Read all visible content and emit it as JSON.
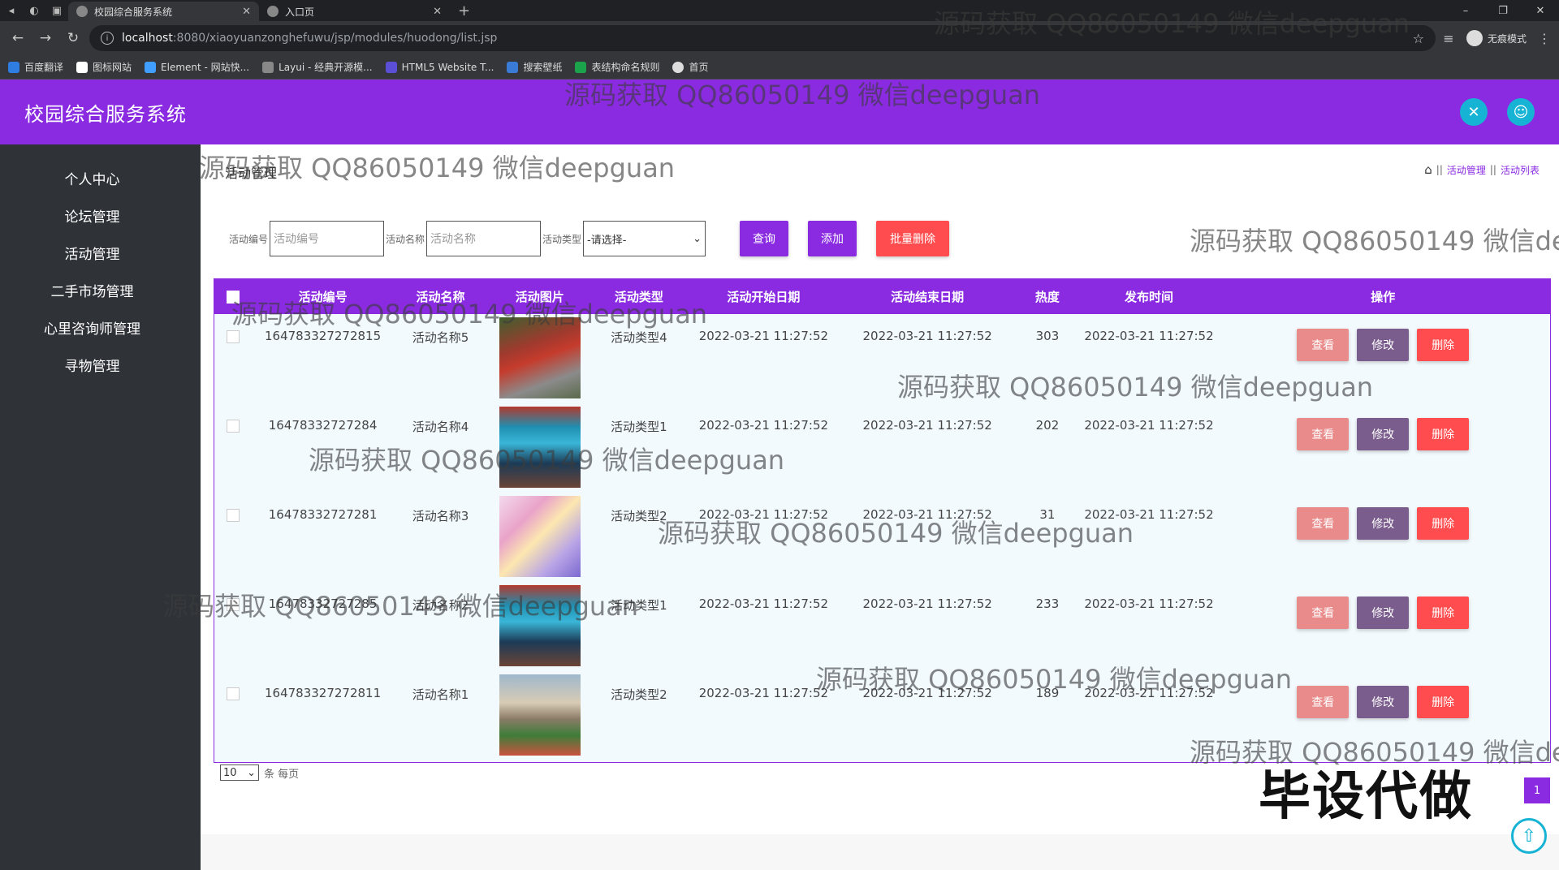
{
  "browser": {
    "tabs": [
      {
        "title": "校园综合服务系统",
        "active": true
      },
      {
        "title": "入口页",
        "active": false
      }
    ],
    "url_host": "localhost",
    "url_path": ":8080/xiaoyuanzonghefuwu/jsp/modules/huodong/list.jsp",
    "incognito_label": "无痕模式",
    "bookmarks": [
      "百度翻译",
      "图标网站",
      "Element - 网站快...",
      "Layui - 经典开源模...",
      "HTML5 Website T...",
      "搜索壁纸",
      "表结构命名规则",
      "首页"
    ]
  },
  "app": {
    "title": "校园综合服务系统",
    "accent": "#8a2be2",
    "sidebar": [
      "个人中心",
      "论坛管理",
      "活动管理",
      "二手市场管理",
      "心里咨询师管理",
      "寻物管理"
    ]
  },
  "page": {
    "title": "活动管理",
    "breadcrumb": [
      "活动管理",
      "活动列表"
    ]
  },
  "search": {
    "label_code": "活动编号",
    "placeholder_code": "活动编号",
    "label_name": "活动名称",
    "placeholder_name": "活动名称",
    "label_type": "活动类型",
    "type_selected": "-请选择-",
    "query": "查询",
    "add": "添加",
    "batch_delete": "批量删除"
  },
  "table": {
    "headers": [
      "活动编号",
      "活动名称",
      "活动图片",
      "活动类型",
      "活动开始日期",
      "活动结束日期",
      "热度",
      "发布时间",
      "操作"
    ],
    "rows": [
      {
        "code": "164783327272815",
        "name": "活动名称5",
        "type": "活动类型4",
        "start": "2022-03-21 11:27:52",
        "end": "2022-03-21 11:27:52",
        "heat": "303",
        "published": "2022-03-21 11:27:52"
      },
      {
        "code": "16478332727284",
        "name": "活动名称4",
        "type": "活动类型1",
        "start": "2022-03-21 11:27:52",
        "end": "2022-03-21 11:27:52",
        "heat": "202",
        "published": "2022-03-21 11:27:52"
      },
      {
        "code": "16478332727281",
        "name": "活动名称3",
        "type": "活动类型2",
        "start": "2022-03-21 11:27:52",
        "end": "2022-03-21 11:27:52",
        "heat": "31",
        "published": "2022-03-21 11:27:52"
      },
      {
        "code": "16478332727285",
        "name": "活动名称2",
        "type": "活动类型1",
        "start": "2022-03-21 11:27:52",
        "end": "2022-03-21 11:27:52",
        "heat": "233",
        "published": "2022-03-21 11:27:52"
      },
      {
        "code": "164783327272811",
        "name": "活动名称1",
        "type": "活动类型2",
        "start": "2022-03-21 11:27:52",
        "end": "2022-03-21 11:27:52",
        "heat": "189",
        "published": "2022-03-21 11:27:52"
      }
    ],
    "op_view": "查看",
    "op_edit": "修改",
    "op_delete": "删除"
  },
  "pager": {
    "page_size": "10",
    "per_page_label": "条 每页",
    "current_page": "1"
  },
  "overlay": {
    "watermark": "源码获取 QQ86050149 微信deepguan",
    "watermark_cut": "源码获取 QQ86050149 微信deep",
    "big_text": "毕设代做"
  }
}
